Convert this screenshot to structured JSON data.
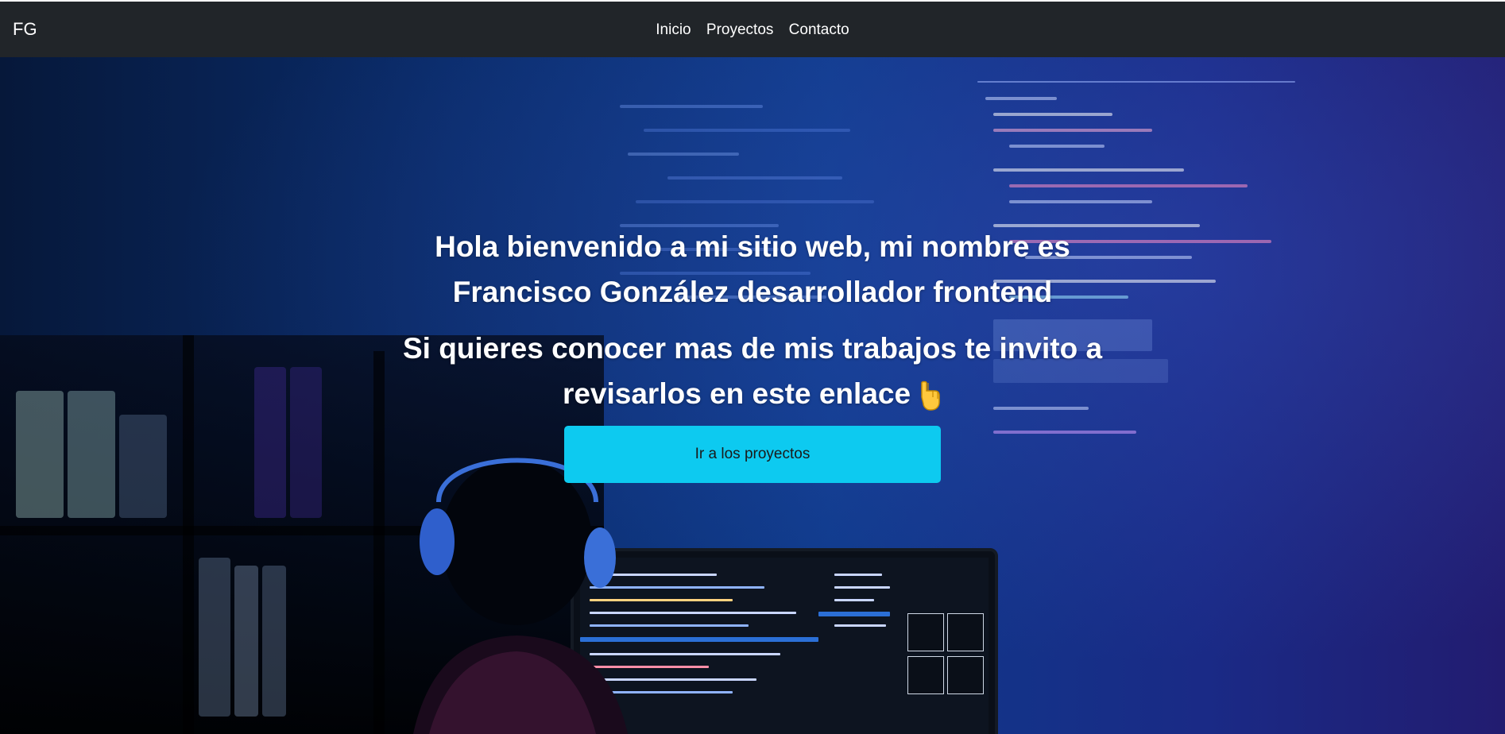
{
  "navbar": {
    "brand": "FG",
    "links": [
      {
        "label": "Inicio"
      },
      {
        "label": "Proyectos"
      },
      {
        "label": "Contacto"
      }
    ]
  },
  "hero": {
    "title": "Hola bienvenido a mi sitio web, mi nombre es Francisco González desarrollador frontend",
    "subtitle": "Si quieres conocer mas de mis trabajos te invito a revisarlos en este enlace",
    "subtitle_icon": "pointing-down-hand-icon",
    "cta_label": "Ir a los proyectos"
  },
  "colors": {
    "navbar_bg": "#212529",
    "cta_bg": "#0dcaf0",
    "hero_bg": "#0e3a8a",
    "text": "#ffffff"
  }
}
